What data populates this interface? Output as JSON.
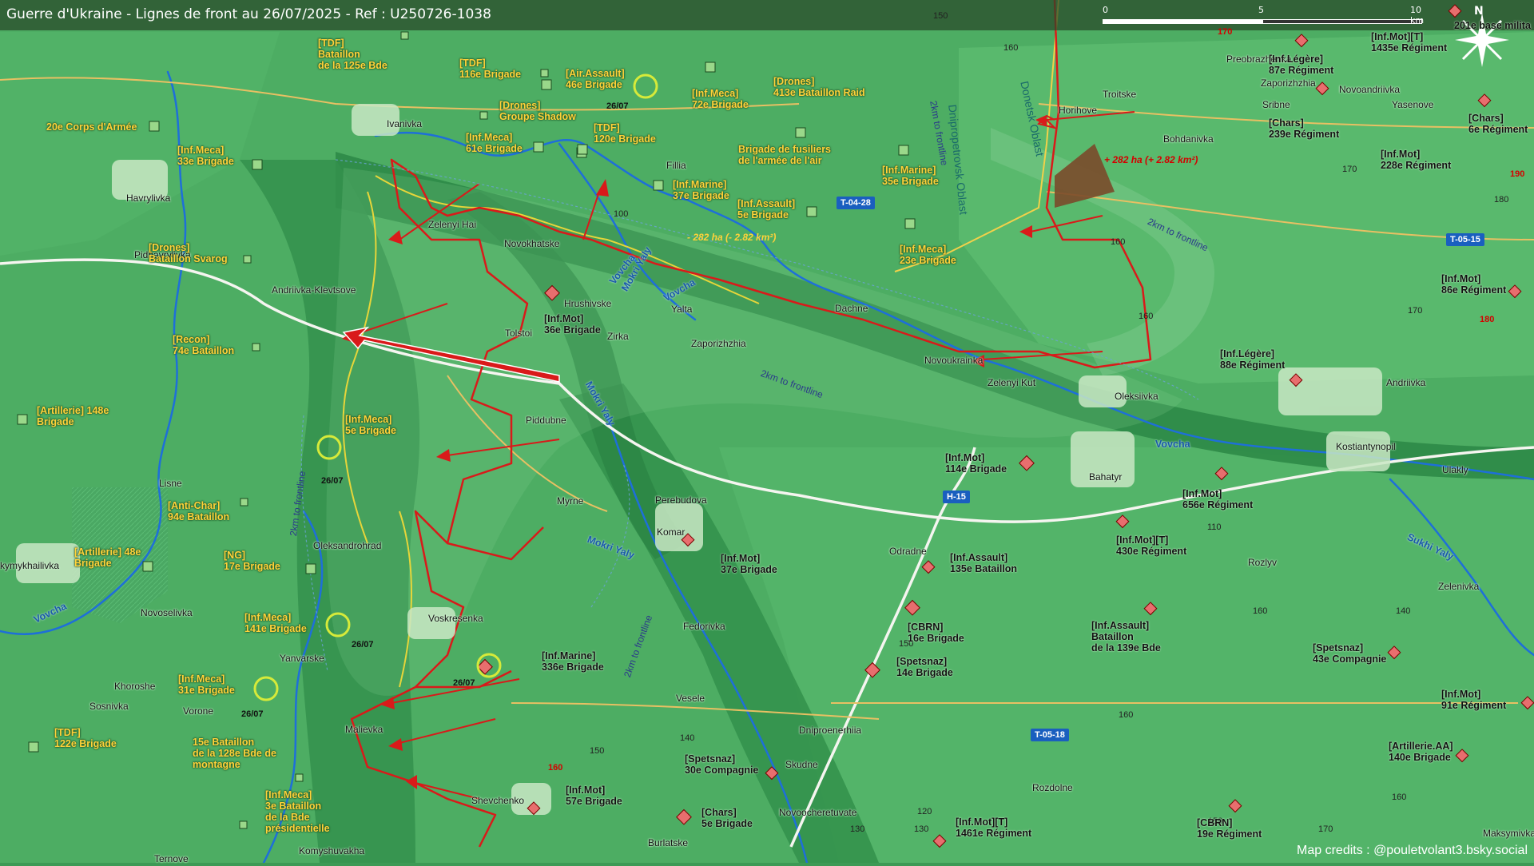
{
  "header": {
    "title": "Guerre d'Ukraine - Lignes de front au 26/07/2025 - Ref : U250726-1038",
    "scale_labels": [
      "0",
      "5",
      "10 km"
    ],
    "north": "N"
  },
  "credits": "Map credits : @pouletvolant3.bsky.social",
  "colors": {
    "ua_label": "#ffd23a",
    "ru_label": "#111111",
    "front": "#d91a1a",
    "river": "#1e6fd9",
    "terrain": "#3d9a55"
  },
  "ua_units": [
    "[TDF]\nBataillon\nde la 125e Bde",
    "[TDF]\n116e Brigade",
    "[Air.Assault]\n46e Brigade",
    "[Inf.Meca]\n72e Brigade",
    "[Drones]\n413e Bataillon Raid",
    "20e Corps d'Armée",
    "[Inf.Meca]\n33e Brigade",
    "[Drones]\nGroupe Shadow",
    "[Inf.Meca]\n61e Brigade",
    "[TDF]\n120e Brigade",
    "Brigade de fusiliers\nde l'armée de l'air",
    "[Inf.Marine]\n35e Brigade",
    "[Inf.Marine]\n37e Brigade",
    "[Inf.Assault]\n5e Brigade",
    "[Drones]\nBataillon Svarog",
    "[Inf.Meca]\n23e Brigade",
    "[Recon]\n74e Bataillon",
    "[Artillerie] 148e\nBrigade",
    "[Inf.Meca]\n5e Brigade",
    "[Anti-Char]\n94e Bataillon",
    "[Artillerie] 48e\nBrigade",
    "[NG]\n17e Brigade",
    "[Inf.Meca]\n141e Brigade",
    "[Inf.Meca]\n31e Brigade",
    "[TDF]\n122e Brigade",
    "15e Bataillon\nde la 128e Bde de\nmontagne",
    "[Inf.Meca]\n3e Bataillon\nde la Bde\nprésidentielle"
  ],
  "ru_units": [
    "201e base milita",
    "[Inf.Mot][T]\n1435e Régiment",
    "[Inf.Légère]\n87e Régiment",
    "[Chars]\n239e Régiment",
    "[Chars]\n6e Régiment",
    "[Inf.Mot]\n228e Régiment",
    "[Inf.Mot]\n36e Brigade",
    "[Inf.Mot]\n86e Régiment",
    "[Inf.Légère]\n88e Régiment",
    "[Inf.Mot]\n114e Brigade",
    "[Inf.Mot]\n656e Régiment",
    "[Inf.Mot][T]\n430e Régiment",
    "[Inf.Mot]\n37e Brigade",
    "[Inf.Assault]\n135e Bataillon",
    "[CBRN]\n16e Brigade",
    "[Inf.Assault]\nBataillon\nde la 139e Bde",
    "[Spetsnaz]\n43e Compagnie",
    "[Spetsnaz]\n14e Brigade",
    "[Inf.Marine]\n336e Brigade",
    "[Inf.Mot]\n91e Régiment",
    "[Artillerie.AA]\n140e Brigade",
    "[Spetsnaz]\n30e Compagnie",
    "[Inf.Mot]\n57e Brigade",
    "[Chars]\n5e Brigade",
    "[Inf.Mot][T]\n1461e Régiment",
    "[CBRN]\n19e Régiment"
  ],
  "towns": [
    "Ivanivka",
    "Havrylivka",
    "Zelenyi Hai",
    "Novokhatske",
    "Pidhavrylivka",
    "Andriivka-Klevtsove",
    "Hrushivske",
    "Tolstoi",
    "Zirka",
    "Yalta",
    "Zaporizhzhia",
    "Dachne",
    "Novoukrainka",
    "Zelenyi Kut",
    "Oleksiivka",
    "Piddubne",
    "Fillia",
    "Troitske",
    "Horihove",
    "Bohdanivka",
    "Preobrazhenka",
    "Zaporizhzhia",
    "Sribne",
    "Novoandriivka",
    "Yasenove",
    "Andriivka",
    "Kostiantynopil",
    "Ulakly",
    "Lisne",
    "Myrne",
    "Perebudova",
    "Komar",
    "Bahatyr",
    "Oleksandrohrad",
    "Odradne",
    "Rozlyv",
    "Zelenivka",
    "kymykhailivka",
    "Novoselivka",
    "Voskresenka",
    "Fedorivka",
    "Yanvarske",
    "Khoroshe",
    "Sosnivka",
    "Vorone",
    "Malievka",
    "Veselе",
    "Dniproenerhiia",
    "Skudne",
    "Rozdolne",
    "Shevchenko",
    "Novoocheretuvate",
    "Burlatske",
    "Komyshuvakha",
    "Ternove",
    "Maksymivka"
  ],
  "rivers": [
    "Vovcha",
    "Vovcha",
    "Mokri Yaly",
    "Mokri Yaly",
    "Mokri Yaly",
    "Vovcha",
    "Sukhi Yaly",
    "Vovcha"
  ],
  "oblasts": [
    "Dnipropetrovsk Oblast",
    "Donetsk Oblast"
  ],
  "frontline_labels": [
    "2km to frontline",
    "2km to frontline",
    "2km to frontline",
    "2km to frontline",
    "2km to frontline"
  ],
  "gains": [
    "+ 282 ha (+ 2.82 km²)",
    "- 282 ha (- 2.82 km²)"
  ],
  "routes": [
    "T-04-28",
    "T-05-15",
    "H-15",
    "T-05-18"
  ],
  "dates": [
    "26/07",
    "26/07",
    "26/07",
    "26/07",
    "26/07"
  ],
  "elevations": [
    "150",
    "160",
    "170",
    "170",
    "190",
    "180",
    "160",
    "160",
    "170",
    "180",
    "110",
    "160",
    "140",
    "150",
    "160",
    "150",
    "160",
    "140",
    "120",
    "130",
    "130",
    "150",
    "160",
    "170",
    "100"
  ]
}
